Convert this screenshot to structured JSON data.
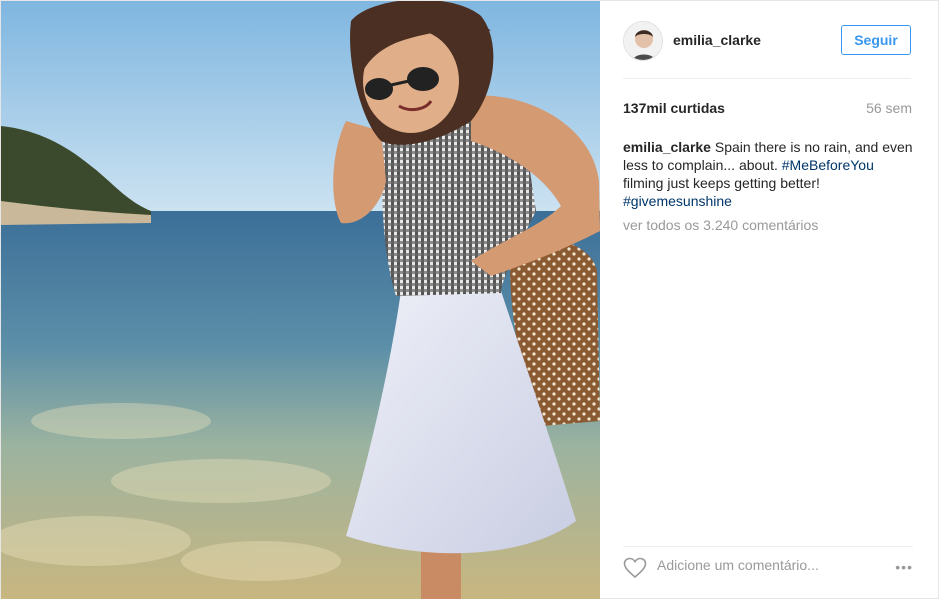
{
  "post": {
    "photo_icon": "beach-photo",
    "author": {
      "username": "emilia_clarke",
      "avatar_icon": "profile-avatar"
    },
    "follow_label": "Seguir",
    "likes": "137mil curtidas",
    "time": "56 sem",
    "caption": {
      "user": "emilia_clarke",
      "text_1": "Spain there is no rain, and even less to complain... about.",
      "hashtag_1": "#MeBeforeYou",
      "text_2": "filming just keeps getting better!",
      "hashtag_2": "#givemesunshine"
    },
    "view_all_comments": "ver todos os 3.240 comentários",
    "comment_placeholder": "Adicione um comentário...",
    "more_icon": "ellipsis-icon",
    "like_icon": "heart-icon",
    "colors": {
      "accent": "#3897f0",
      "hashtag": "#003569",
      "muted": "#999999"
    }
  }
}
